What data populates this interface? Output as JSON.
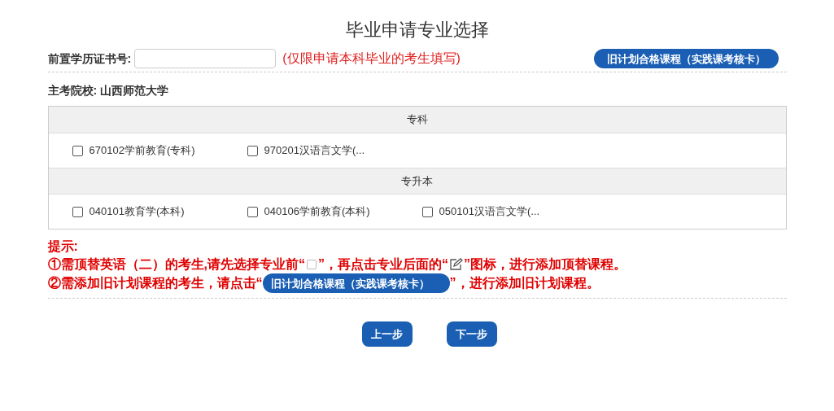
{
  "title": "毕业申请专业选择",
  "cert_field": {
    "label": "前置学历证书号:",
    "note": "(仅限申请本科毕业的考生填写)"
  },
  "old_plan_button": "旧计划合格课程（实践课考核卡）",
  "school": {
    "label": "主考院校:",
    "value": "山西师范大学"
  },
  "groups": [
    {
      "heading": "专科",
      "majors": [
        {
          "label": "670102学前教育(专科)",
          "checked": false
        },
        {
          "label": "970201汉语言文学(...",
          "checked": false
        }
      ]
    },
    {
      "heading": "专升本",
      "majors": [
        {
          "label": "040101教育学(本科)",
          "checked": false
        },
        {
          "label": "040106学前教育(本科)",
          "checked": false
        },
        {
          "label": "050101汉语言文学(...",
          "checked": false
        }
      ]
    }
  ],
  "hint": {
    "title": "提示:",
    "line_1": [
      "①需顶替英语（二）的考生,请先选择专业前“",
      "”，再点击专业后面的“",
      "”图标，进行添加顶替课程。"
    ],
    "line_2": [
      "②需添加旧计划课程的考生，请点击“",
      "旧计划合格课程（实践课考核卡）",
      "”，进行添加旧计划课程。"
    ]
  },
  "buttons": [
    "上一步",
    "下一步"
  ]
}
